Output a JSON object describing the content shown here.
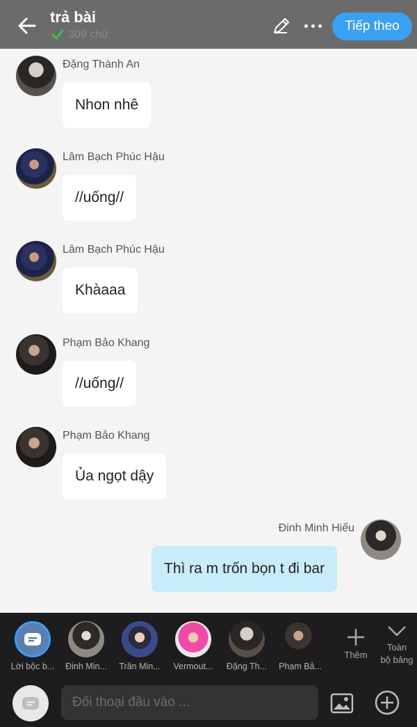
{
  "header": {
    "title": "trả bài",
    "word_count": "309 chữ",
    "next_label": "Tiếp theo"
  },
  "messages": [
    {
      "sender": "Đặng Thành An",
      "text": "Nhon nhê",
      "mine": false
    },
    {
      "sender": "Lâm Bạch Phúc Hậu",
      "text": "//uống//",
      "mine": false
    },
    {
      "sender": "Lâm Bạch Phúc Hậu",
      "text": "Khàaaa",
      "mine": false
    },
    {
      "sender": "Phạm Bảo Khang",
      "text": "//uống//",
      "mine": false
    },
    {
      "sender": "Phạm Bảo Khang",
      "text": "Ủa ngọt dậy",
      "mine": false
    },
    {
      "sender": "Đinh Minh Hiếu",
      "text": "Thì ra m trốn bọn t đi bar",
      "mine": true
    }
  ],
  "characters": [
    {
      "label": "Lời bộc b..."
    },
    {
      "label": "Đinh Min..."
    },
    {
      "label": "Trần Min..."
    },
    {
      "label": "Vermout..."
    },
    {
      "label": "Đặng Th..."
    },
    {
      "label": "Phạm Bả..."
    }
  ],
  "add_label": "Thêm",
  "collapse_label_1": "Toàn",
  "collapse_label_2": "bộ bảng",
  "input": {
    "placeholder": "Đối thoại đầu vào ..."
  },
  "colors": {
    "accent": "#3aa0f2",
    "my_bubble": "#c9ecfb",
    "header": "#6b6b6b",
    "bottom_bar": "#1d1d1f"
  }
}
